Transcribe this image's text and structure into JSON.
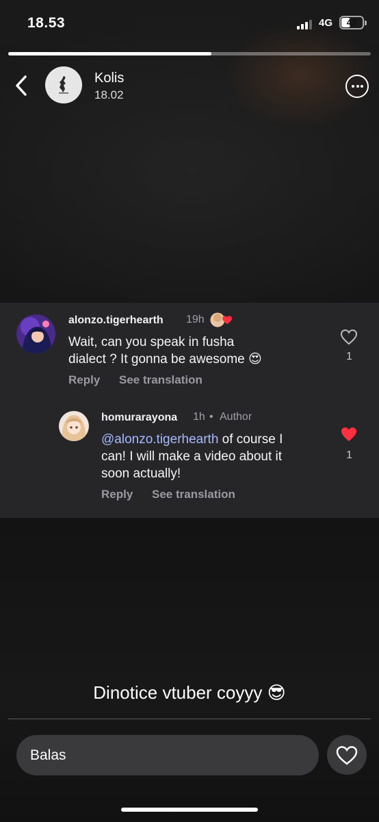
{
  "status_bar": {
    "time": "18.53",
    "network": "4G",
    "battery": "43",
    "battery_fraction": 0.43
  },
  "story": {
    "progress_fraction": 0.56,
    "username": "Kolis",
    "posted_time": "18.02",
    "caption": "Dinotice vtuber coyyy 😎",
    "reply_placeholder": "Balas"
  },
  "comment": {
    "username": "alonzo.tigerhearth",
    "time": "19h",
    "text_line1": "Wait, can you speak in fusha",
    "text_line2": "dialect ? It gonna be awesome 😍",
    "reply_label": "Reply",
    "translate_label": "See translation",
    "like_count": "1",
    "liked": false
  },
  "reply": {
    "username": "homurarayona",
    "time": "1h",
    "separator": "•",
    "badge": "Author",
    "mention": "@alonzo.tigerhearth",
    "text_rest_line1": " of course I",
    "text_line2": "can! I will make a video about it",
    "text_line3": "soon actually!",
    "reply_label": "Reply",
    "translate_label": "See translation",
    "like_count": "1",
    "liked": true
  },
  "icons": {
    "back": "chevron-left-icon",
    "more": "more-options-icon",
    "like": "heart-outline-icon",
    "liked": "heart-filled-icon",
    "send_like": "heart-outline-icon"
  },
  "colors": {
    "liked_heart": "#ff3040",
    "mention": "#a9b9ff",
    "card_bg": "#262629"
  }
}
